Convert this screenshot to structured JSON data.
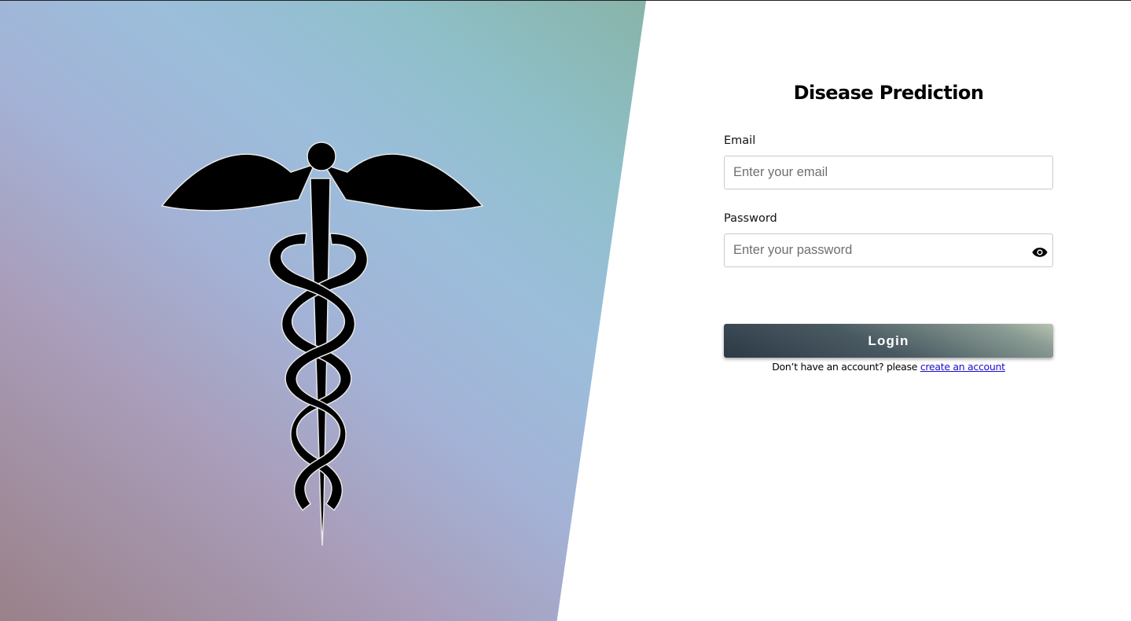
{
  "hero": {
    "emblem_icon": "caduceus-icon",
    "gradient_colors": [
      "#9a8189",
      "#a99dba",
      "#9bbedb",
      "#88b4a8"
    ]
  },
  "form": {
    "title": "Disease Prediction",
    "email": {
      "label": "Email",
      "placeholder": "Enter your email",
      "value": ""
    },
    "password": {
      "label": "Password",
      "placeholder": "Enter your password",
      "value": "",
      "toggle_icon": "eye-icon"
    },
    "login_label": "Login",
    "signup_prompt": "Don’t have an account? please",
    "signup_link": "create an account"
  },
  "colors": {
    "link": "#1a0dcc",
    "button_dark": "#2c3946",
    "button_light": "#b9c4b1"
  }
}
